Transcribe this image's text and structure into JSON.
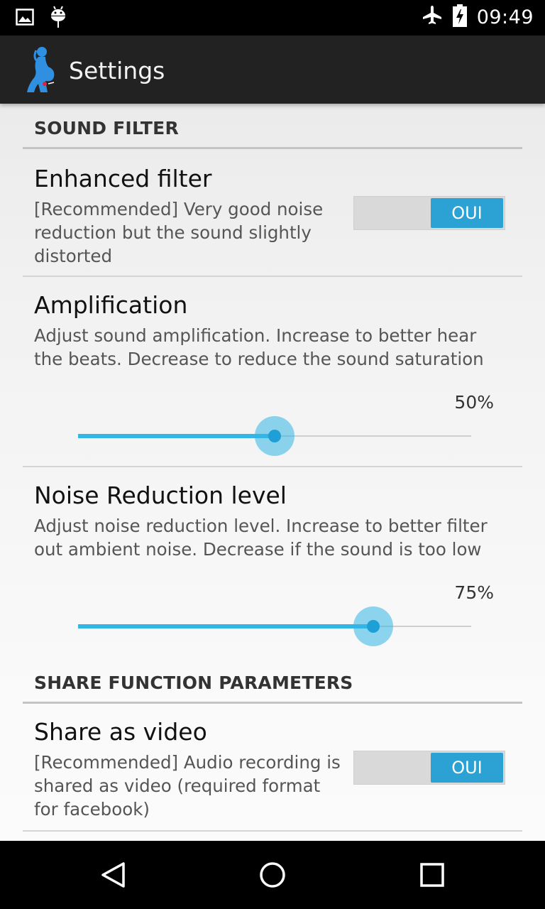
{
  "status_bar": {
    "time": "09:49",
    "left_icons": [
      "image-icon",
      "android-debug-icon"
    ],
    "right_icons": [
      "airplane-mode-icon",
      "battery-charging-icon"
    ]
  },
  "action_bar": {
    "title": "Settings",
    "icon": "app-logo-icon"
  },
  "sections": {
    "sound_filter": {
      "header": "SOUND FILTER",
      "enhanced_filter": {
        "title": "Enhanced filter",
        "summary": "[Recommended] Very good noise reduction but the sound slightly distorted",
        "switch_label": "OUI",
        "checked": true
      },
      "amplification": {
        "title": "Amplification",
        "summary": "Adjust sound amplification. Increase to better hear the beats. Decrease to reduce the sound saturation",
        "value_label": "50%",
        "value": 50
      },
      "noise_reduction": {
        "title": "Noise Reduction level",
        "summary": "Adjust noise reduction level. Increase to better filter out ambient noise. Decrease if the sound is too low",
        "value_label": "75%",
        "value": 75
      }
    },
    "share": {
      "header": "SHARE FUNCTION PARAMETERS",
      "share_as_video": {
        "title": "Share as video",
        "summary": "[Recommended] Audio recording is shared as video (required format for facebook)",
        "switch_label": "OUI",
        "checked": true
      }
    }
  },
  "nav_bar": {
    "icons": [
      "back-icon",
      "home-icon",
      "recents-icon"
    ]
  },
  "colors": {
    "accent": "#33b5e5",
    "switch_on": "#2ba2d3",
    "action_bar": "#222222"
  }
}
